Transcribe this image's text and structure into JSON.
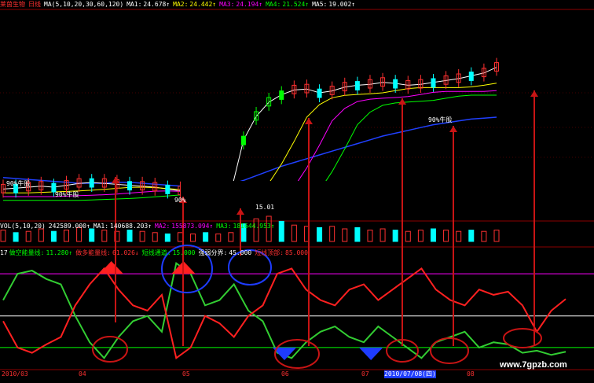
{
  "main_header": {
    "code": "莱茵生物",
    "period": "日线",
    "ma_params": "MA(5,10,20,30,60,120)",
    "ma": [
      {
        "label": "MA1:",
        "value": "24.678↑",
        "color": "#ffffff"
      },
      {
        "label": "MA2:",
        "value": "24.442↑",
        "color": "#ffff00"
      },
      {
        "label": "MA3:",
        "value": "24.194↑",
        "color": "#ff00ff"
      },
      {
        "label": "MA4:",
        "value": "21.524↑",
        "color": "#00ff00"
      },
      {
        "label": "MA5:",
        "value": "19.002↑",
        "color": "#ffffff"
      }
    ]
  },
  "annotations": {
    "bull_1": "90%牛股",
    "bull_2": "90%牛股",
    "bull_3": "90%",
    "bull_4": "90%牛股",
    "price_marker": "15.01"
  },
  "vol_header": {
    "label": "VOL(5,10,20)",
    "items": [
      {
        "label": "",
        "value": "242589.000↑",
        "color": "#ffffff"
      },
      {
        "label": "MA1:",
        "value": "140688.203↑",
        "color": "#ffffff"
      },
      {
        "label": "MA2:",
        "value": "155873.094↑",
        "color": "#ff00ff"
      },
      {
        "label": "MA3:",
        "value": "181644.953↑",
        "color": "#00ff00"
      }
    ]
  },
  "ind_header": {
    "items": [
      {
        "label": "17",
        "value": "",
        "color": "#ffffff"
      },
      {
        "label": "做空能量线:",
        "value": "11.280↑",
        "color": "#00ff00"
      },
      {
        "label": "做多能量线:",
        "value": "61.026↓",
        "color": "#ff3030"
      },
      {
        "label": "短线通道:",
        "value": "15.000",
        "color": "#00ff00"
      },
      {
        "label": "强弱分界:",
        "value": "45.000",
        "color": "#ffffff"
      },
      {
        "label": "短线顶部:",
        "value": "85.000",
        "color": "#ff3030"
      }
    ]
  },
  "date_axis": [
    "2010/03",
    "04",
    "05",
    "06",
    "07",
    "2010/07/08(四)",
    "08"
  ],
  "watermark": "www.7gpzb.com",
  "colors": {
    "bg": "#000000",
    "grid": "#8b0000",
    "up": "#ff3030",
    "down": "#00ffff",
    "bear_line": "#32cd32",
    "bull_line": "#ff2020",
    "arrow": "#c81414",
    "circle": "#1e3cff"
  },
  "chart_data": [
    {
      "type": "candlestick",
      "title": "莱茵生物 日线",
      "note": "price pane; relative ordering only, axis values not printed",
      "series": [
        {
          "name": "MA1",
          "values": [
            11.8,
            11.9,
            12.0,
            12.1,
            12.0,
            12.2,
            12.4,
            12.5,
            12.4,
            12.3,
            12.2,
            12.1,
            12.0,
            11.8,
            11.6,
            11.5,
            11.4,
            11.4,
            11.5,
            17.0,
            19.5,
            21.0,
            21.8,
            22.3,
            22.4,
            22.0,
            22.2,
            22.6,
            22.8,
            22.9,
            23.1,
            23.0,
            22.8,
            22.9,
            23.1,
            23.3,
            23.5,
            23.8,
            24.1,
            24.7
          ]
        },
        {
          "name": "MA5",
          "values": [
            12.6,
            12.5,
            12.4,
            12.3,
            12.2,
            12.1,
            12.0,
            12.0,
            12.0,
            12.1,
            12.1,
            12.0,
            11.9,
            11.8,
            11.7,
            11.7,
            11.7,
            11.8,
            11.9,
            12.3,
            12.8,
            13.3,
            13.8,
            14.2,
            14.6,
            15.0,
            15.4,
            15.8,
            16.2,
            16.6,
            17.0,
            17.3,
            17.6,
            17.9,
            18.2,
            18.4,
            18.6,
            18.8,
            18.9,
            19.0
          ]
        }
      ]
    },
    {
      "type": "bar",
      "title": "VOL(5,10,20)",
      "series": [
        {
          "name": "VOL",
          "values": [
            9,
            7,
            8,
            10,
            8,
            9,
            11,
            10,
            9,
            8,
            9,
            8,
            7,
            6,
            7,
            6,
            7,
            6,
            7,
            14,
            18,
            20,
            16,
            13,
            12,
            11,
            12,
            10,
            11,
            9,
            10,
            9,
            8,
            9,
            10,
            9,
            8,
            9,
            8,
            9
          ]
        }
      ]
    },
    {
      "type": "line",
      "title": "17",
      "ylim": [
        0,
        100
      ],
      "reference_lines": [
        15,
        45,
        85
      ],
      "series": [
        {
          "name": "做空能量线",
          "values": [
            60,
            85,
            88,
            80,
            75,
            45,
            20,
            5,
            25,
            40,
            45,
            30,
            95,
            85,
            55,
            60,
            75,
            50,
            40,
            10,
            5,
            20,
            30,
            35,
            25,
            20,
            35,
            25,
            15,
            5,
            20,
            25,
            30,
            15,
            20,
            18,
            10,
            12,
            8,
            11
          ]
        },
        {
          "name": "做多能量线",
          "values": [
            40,
            15,
            10,
            18,
            25,
            55,
            75,
            90,
            70,
            55,
            50,
            65,
            5,
            15,
            45,
            38,
            25,
            45,
            55,
            85,
            90,
            70,
            60,
            55,
            70,
            75,
            60,
            70,
            80,
            90,
            70,
            60,
            55,
            70,
            65,
            68,
            55,
            30,
            50,
            61
          ]
        }
      ]
    }
  ]
}
